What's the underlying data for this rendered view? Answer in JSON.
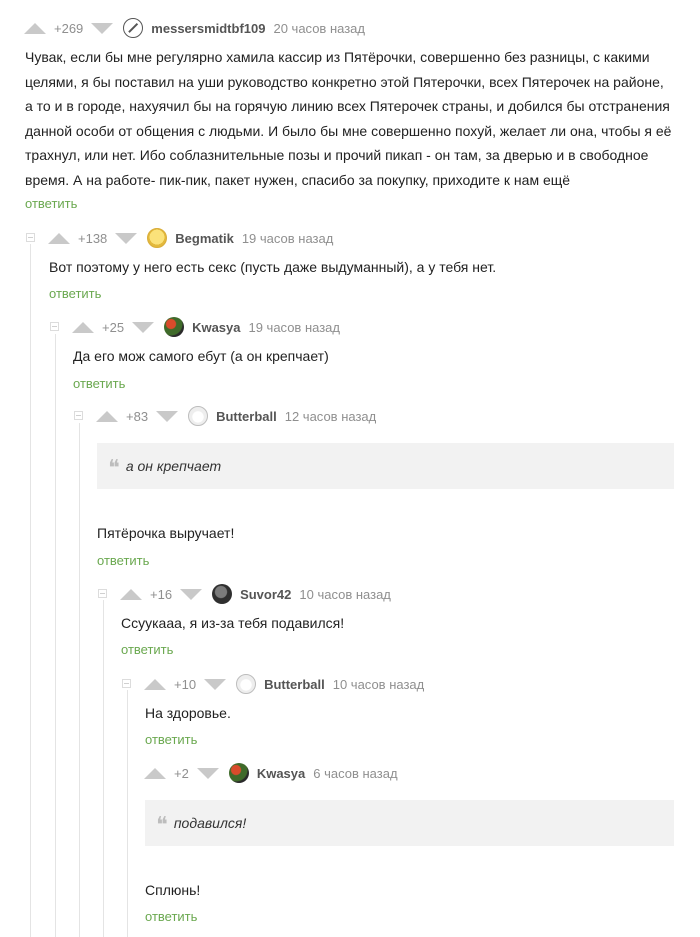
{
  "comments": [
    {
      "score": "+269",
      "user": "messersmidtbf109",
      "time": "20 часов назад",
      "lines": [
        "Чувак, если бы мне регулярно хамила кассир из Пятёрочки, совершенно без разницы, с какими",
        "целями, я бы поставил на уши руководство конкретно этой Пятерочки, всех Пятерочек на районе,",
        "а то и в городе, нахуячил бы на горячую линию всех Пятерочек страны, и добился бы отстранения",
        "данной особи от общения с людьми. И было бы мне совершенно похуй, желает ли она, чтобы я её",
        "трахнул, или нет. Ибо соблазнительные позы и прочий пикап - он там, за дверью и в свободное",
        "время. А на работе- пик-пик,  пакет нужен, спасибо за покупку, приходите к нам ещё"
      ],
      "reply": "ответить"
    },
    {
      "score": "+138",
      "user": "Begmatik",
      "time": "19 часов назад",
      "text": "Вот поэтому у него есть секс (пусть даже выдуманный), а у тебя нет.",
      "reply": "ответить"
    },
    {
      "score": "+25",
      "user": "Kwasya",
      "time": "19 часов назад",
      "text": "Да его мож самого ебут (а он крепчает)",
      "reply": "ответить"
    },
    {
      "score": "+83",
      "user": "Butterball",
      "time": "12 часов назад",
      "quote": "а он крепчает",
      "text": "Пятёрочка выручает!",
      "reply": "ответить"
    },
    {
      "score": "+16",
      "user": "Suvor42",
      "time": "10 часов назад",
      "text": "Ссуукааа, я из-за тебя подавился!",
      "reply": "ответить"
    },
    {
      "score": "+10",
      "user": "Butterball",
      "time": "10 часов назад",
      "text": "На здоровье.",
      "reply": "ответить"
    },
    {
      "score": "+2",
      "user": "Kwasya",
      "time": "6 часов назад",
      "quote": "подавился!",
      "text": "Сплюнь!",
      "reply": "ответить"
    }
  ],
  "quote_mark": "❝",
  "colors": {
    "reply_link": "#6aa84f",
    "vote_arrow": "#c9c9c9",
    "meta_text": "#8f8f8f",
    "quote_bg": "#f2f2f2",
    "thread_line": "#e4e4e4"
  },
  "icons": [
    "vote-up-icon",
    "vote-down-icon",
    "collapse-icon",
    "quote-icon"
  ]
}
